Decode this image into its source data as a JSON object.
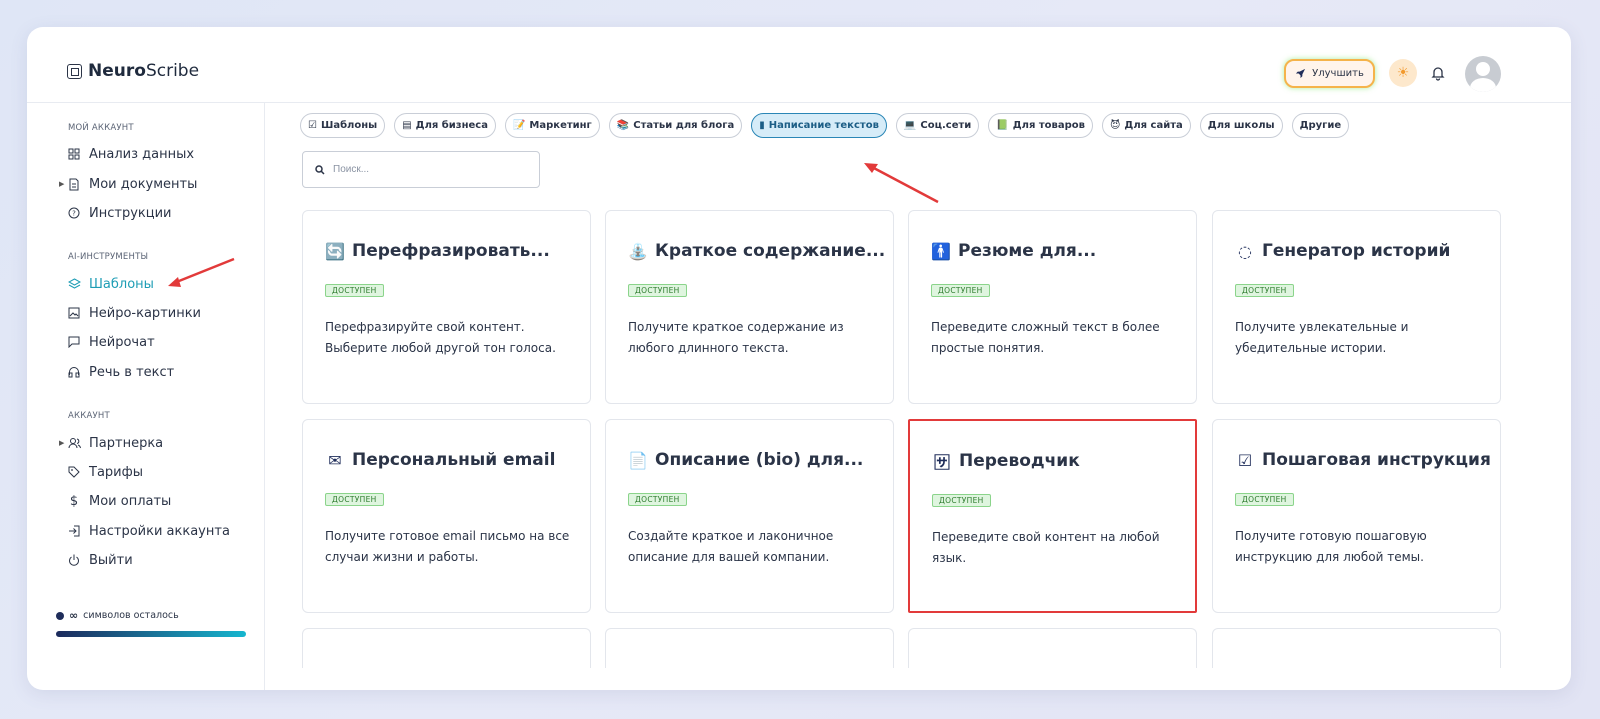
{
  "app": {
    "logo_bold": "Neuro",
    "logo_light": "Scribe"
  },
  "header": {
    "upgrade_label": "Улучшить",
    "theme_icon": "sun-icon",
    "bell_icon": "bell-icon"
  },
  "sidebar": {
    "sections": [
      {
        "title": "МОЙ АККАУНТ",
        "items": [
          {
            "label": "Анализ данных",
            "icon": "grid-icon"
          },
          {
            "label": "Мои документы",
            "icon": "document-icon"
          },
          {
            "label": "Инструкции",
            "icon": "help-icon"
          }
        ]
      },
      {
        "title": "AI-ИНСТРУМЕНТЫ",
        "items": [
          {
            "label": "Шаблоны",
            "icon": "layers-icon"
          },
          {
            "label": "Нейро-картинки",
            "icon": "image-icon"
          },
          {
            "label": "Нейрочат",
            "icon": "chat-icon"
          },
          {
            "label": "Речь в текст",
            "icon": "headphones-icon"
          }
        ]
      },
      {
        "title": "АККАУНТ",
        "items": [
          {
            "label": "Партнерка",
            "icon": "users-icon"
          },
          {
            "label": "Тарифы",
            "icon": "tag-icon"
          },
          {
            "label": "Мои оплаты",
            "icon": "dollar-icon"
          },
          {
            "label": "Настройки аккаунта",
            "icon": "login-icon"
          },
          {
            "label": "Выйти",
            "icon": "power-icon"
          }
        ]
      }
    ],
    "credits_symbol": "∞",
    "credits_text": "символов осталось",
    "credits_progress": 1.0
  },
  "filters": [
    {
      "label": "Шаблоны",
      "icon": "☑"
    },
    {
      "label": "Для бизнеса",
      "icon": "▤"
    },
    {
      "label": "Маркетинг",
      "icon": "📝"
    },
    {
      "label": "Статьи для блога",
      "icon": "📚"
    },
    {
      "label": "Написание текстов",
      "icon": "▮"
    },
    {
      "label": "Соц.сети",
      "icon": "💻"
    },
    {
      "label": "Для товаров",
      "icon": "📗"
    },
    {
      "label": "Для сайта",
      "icon": "😈"
    },
    {
      "label": "Для школы",
      "icon": ""
    },
    {
      "label": "Другие",
      "icon": ""
    }
  ],
  "search": {
    "placeholder": "Поиск..."
  },
  "cards": [
    {
      "title": "Перефразировать...",
      "icon": "🔄",
      "badge": "ДОСТУПЕН",
      "desc": "Перефразируйте свой контент. Выберите любой другой тон голоса."
    },
    {
      "title": "Краткое содержание...",
      "icon": "⛲",
      "badge": "ДОСТУПЕН",
      "desc": "Получите краткое содержание из любого длинного текста."
    },
    {
      "title": "Резюме для...",
      "icon": "🚹",
      "badge": "ДОСТУПЕН",
      "desc": "Переведите сложный текст в более простые понятия."
    },
    {
      "title": "Генератор историй",
      "icon": "◌",
      "badge": "ДОСТУПЕН",
      "desc": "Получите увлекательные и убедительные истории."
    },
    {
      "title": "Персональный email",
      "icon": "✉",
      "badge": "ДОСТУПЕН",
      "desc": "Получите готовое email письмо на все случаи жизни и работы."
    },
    {
      "title": "Описание (bio) для...",
      "icon": "📄",
      "badge": "ДОСТУПЕН",
      "desc": "Создайте краткое и лаконичное описание для вашей компании."
    },
    {
      "title": "Переводчик",
      "icon": "🈂",
      "badge": "ДОСТУПЕН",
      "desc": "Переведите свой контент на любой язык."
    },
    {
      "title": "Пошаговая инструкция",
      "icon": "☑",
      "badge": "ДОСТУПЕН",
      "desc": "Получите готовую пошаговую инструкцию для любой темы."
    }
  ]
}
